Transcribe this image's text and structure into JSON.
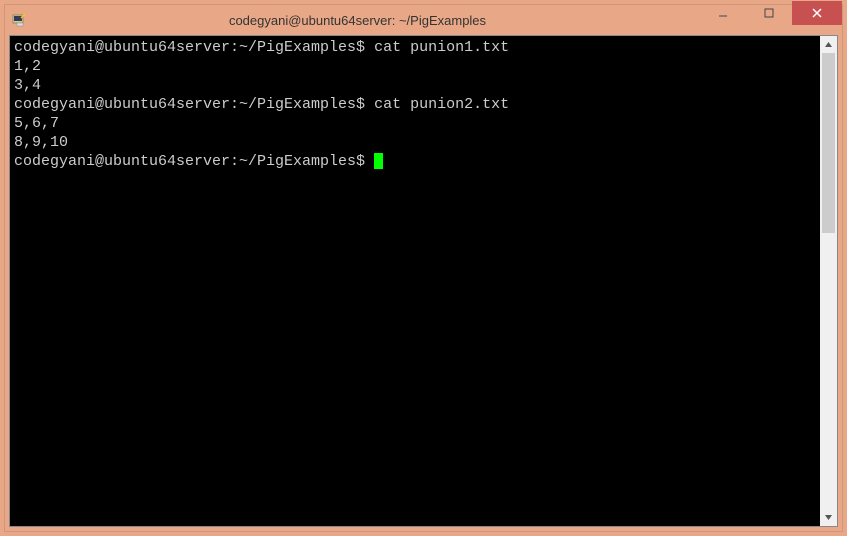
{
  "window": {
    "title": "codegyani@ubuntu64server: ~/PigExamples"
  },
  "terminal": {
    "lines": [
      {
        "prompt": "codegyani@ubuntu64server:~/PigExamples$ ",
        "cmd": "cat punion1.txt"
      },
      {
        "text": "1,2"
      },
      {
        "text": "3,4"
      },
      {
        "prompt": "codegyani@ubuntu64server:~/PigExamples$ ",
        "cmd": "cat punion2.txt"
      },
      {
        "text": "5,6,7"
      },
      {
        "text": "8,9,10"
      },
      {
        "prompt": "codegyani@ubuntu64server:~/PigExamples$ ",
        "cursor": true
      }
    ]
  }
}
